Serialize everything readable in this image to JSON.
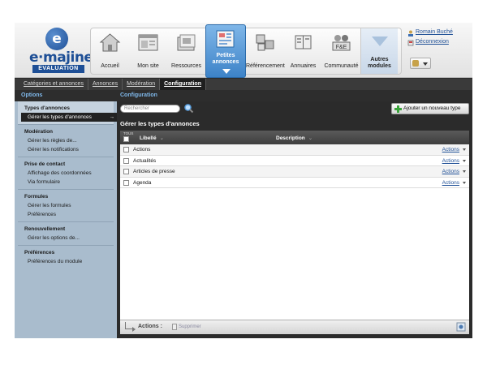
{
  "logo": {
    "name": "e·majine",
    "subtitle": "EVALUATION"
  },
  "modules": [
    {
      "label": "Accueil",
      "icon": "house-icon"
    },
    {
      "label": "Mon site",
      "icon": "website-icon"
    },
    {
      "label": "Ressources",
      "icon": "folder-icon"
    },
    {
      "label": "Petites annonces",
      "icon": "classified-ads-icon",
      "active": true
    },
    {
      "label": "Référencement",
      "icon": "cubes-icon"
    },
    {
      "label": "Annuaires",
      "icon": "directory-book-icon"
    },
    {
      "label": "Communauté",
      "icon": "community-icon"
    },
    {
      "label": "Autres modules",
      "icon": "chevron-down-icon"
    }
  ],
  "user": {
    "name": "Romain Buché",
    "logout": "Déconnexion"
  },
  "tabs": [
    "Catégories et annonces",
    "Annonces",
    "Modération",
    "Configuration"
  ],
  "active_tab": "Configuration",
  "sidebar": {
    "title": "Options",
    "groups": [
      {
        "title": "Types d'annonces",
        "items": [
          "Gérer les types d'annonces"
        ]
      },
      {
        "title": "Modération",
        "items": [
          "Gérer les règles de...",
          "Gérer les notifications"
        ]
      },
      {
        "title": "Prise de contact",
        "items": [
          "Affichage des coordonnées",
          "Via formulaire"
        ]
      },
      {
        "title": "Formules",
        "items": [
          "Gérer les formules",
          "Préférences"
        ]
      },
      {
        "title": "Renouvellement",
        "items": [
          "Gérer les options de..."
        ]
      },
      {
        "title": "Préférences",
        "items": [
          "Préférences du module"
        ]
      }
    ]
  },
  "main": {
    "title": "Configuration",
    "search_placeholder": "Rechercher",
    "add_button": "Ajouter un nouveau type",
    "panel_title": "Gérer les types d'annonces",
    "columns": {
      "all": "TOUS",
      "libelle": "Libellé",
      "description": "Description"
    },
    "rows": [
      {
        "libelle": "Actions",
        "actions": "Actions"
      },
      {
        "libelle": "Actualités",
        "actions": "Actions"
      },
      {
        "libelle": "Articles de presse",
        "actions": "Actions"
      },
      {
        "libelle": "Agenda",
        "actions": "Actions"
      }
    ],
    "footer": {
      "actions_label": "Actions :",
      "delete_label": "Supprimer"
    }
  },
  "colors": {
    "accent": "#3d83c8",
    "link": "#1e4f96",
    "sidebar": "#a9bccd",
    "header_text": "#7fb8ea"
  }
}
